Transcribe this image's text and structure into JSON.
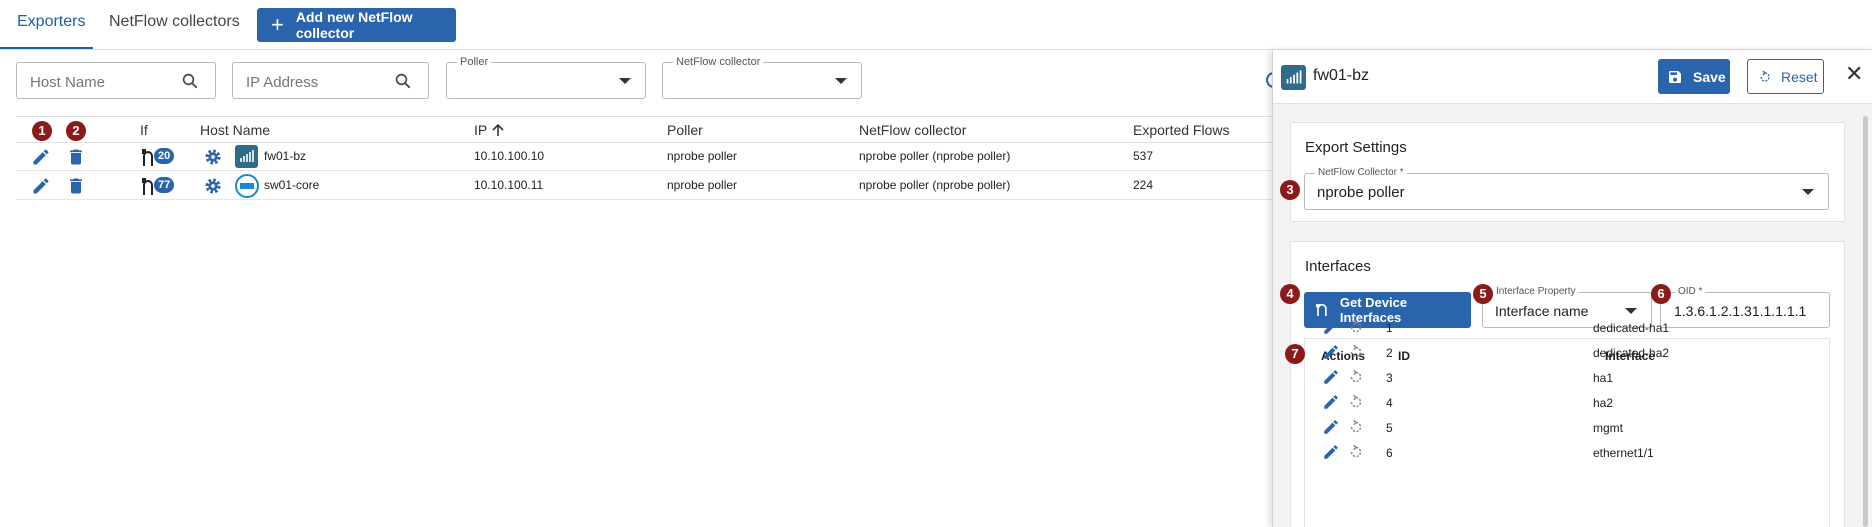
{
  "tabs": [
    {
      "label": "Exporters"
    },
    {
      "label": "NetFlow collectors"
    }
  ],
  "add_button": {
    "label": "Add new NetFlow collector"
  },
  "filters": {
    "host_name_placeholder": "Host Name",
    "ip_placeholder": "IP Address",
    "poller_label": "Poller",
    "collector_label": "NetFlow collector"
  },
  "table": {
    "headers": {
      "if": "If",
      "host_name": "Host Name",
      "ip": "IP",
      "poller": "Poller",
      "collector": "NetFlow collector",
      "flows": "Exported Flows"
    },
    "rows": [
      {
        "if_count": "20",
        "host_name": "fw01-bz",
        "ip": "10.10.100.10",
        "poller": "nprobe poller",
        "collector": "nprobe poller (nprobe poller)",
        "flows": "537",
        "vendor_icon": "paloalto-logo-icon"
      },
      {
        "if_count": "77",
        "host_name": "sw01-core",
        "ip": "10.10.100.11",
        "poller": "nprobe poller",
        "collector": "nprobe poller (nprobe poller)",
        "flows": "224",
        "vendor_icon": "dell-logo-icon"
      }
    ]
  },
  "callouts": [
    "1",
    "2",
    "3",
    "4",
    "5",
    "6",
    "7"
  ],
  "panel": {
    "title": "fw01-bz",
    "save_label": "Save",
    "reset_label": "Reset",
    "close_label": "✕",
    "export_settings": {
      "title": "Export Settings",
      "collector_label": "NetFlow Collector *",
      "collector_value": "nprobe poller"
    },
    "interfaces": {
      "title": "Interfaces",
      "get_button": "Get Device Interfaces",
      "property_label": "Interface Property",
      "property_value": "Interface name",
      "oid_label": "OID *",
      "oid_value": "1.3.6.1.2.1.31.1.1.1.1",
      "headers": {
        "actions": "Actions",
        "id": "ID",
        "interface": "Interface"
      },
      "rows": [
        {
          "id": "1",
          "name": "dedicated-ha1"
        },
        {
          "id": "2",
          "name": "dedicated-ha2"
        },
        {
          "id": "3",
          "name": "ha1"
        },
        {
          "id": "4",
          "name": "ha2"
        },
        {
          "id": "5",
          "name": "mgmt"
        },
        {
          "id": "6",
          "name": "ethernet1/1"
        }
      ]
    }
  },
  "colors": {
    "primary": "#2a64ad",
    "badge": "#8b1a1a",
    "panel_bg": "#f3f3f3"
  }
}
